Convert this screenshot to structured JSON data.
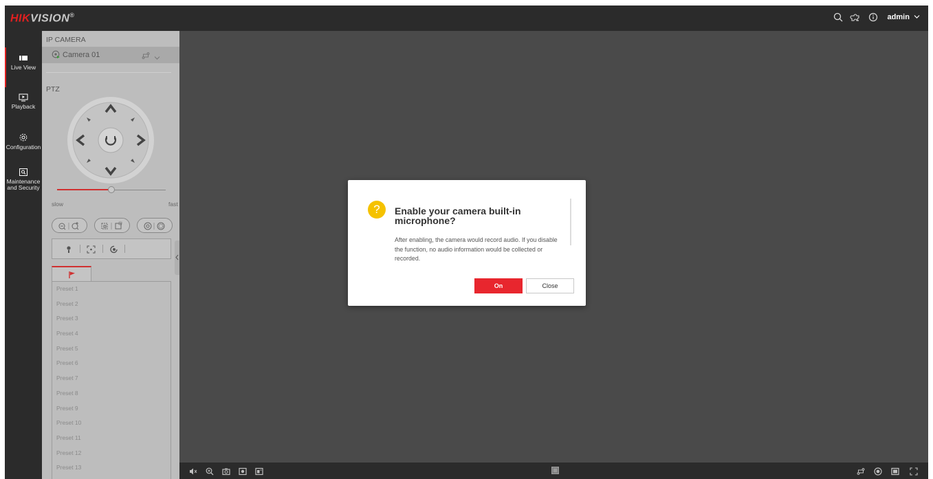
{
  "brand": {
    "logo_hik": "HIK",
    "logo_vision": "VISION",
    "logo_reg": "®",
    "accent_color": "#e02020"
  },
  "topbar": {
    "user": "admin",
    "icons": [
      "search-icon",
      "puzzle-icon",
      "info-icon",
      "chevron-down-icon"
    ]
  },
  "nav": {
    "items": [
      {
        "label": "Live View",
        "icon": "live-view-icon",
        "active": true
      },
      {
        "label": "Playback",
        "icon": "playback-icon",
        "active": false
      },
      {
        "label": "Configuration",
        "icon": "gear-icon",
        "active": false
      },
      {
        "label": "Maintenance and Security",
        "label_line1": "Maintenance",
        "label_line2": "and Security",
        "icon": "maintenance-icon",
        "active": false
      }
    ]
  },
  "panel": {
    "title": "IP CAMERA",
    "camera_name": "Camera 01",
    "ptz_label": "PTZ",
    "speed_slow": "slow",
    "speed_fast": "fast",
    "speed_level": 0.5,
    "presets": [
      "Preset 1",
      "Preset 2",
      "Preset 3",
      "Preset 4",
      "Preset 5",
      "Preset 6",
      "Preset 7",
      "Preset 8",
      "Preset 9",
      "Preset 10",
      "Preset 11",
      "Preset 12",
      "Preset 13"
    ]
  },
  "dialog": {
    "title": "Enable your camera built-in microphone?",
    "body": "After enabling, the camera would record audio. If you disable the function, no audio information would be collected or recorded.",
    "on_label": "On",
    "close_label": "Close",
    "on_color": "#e8262e",
    "icon": "question-icon"
  }
}
